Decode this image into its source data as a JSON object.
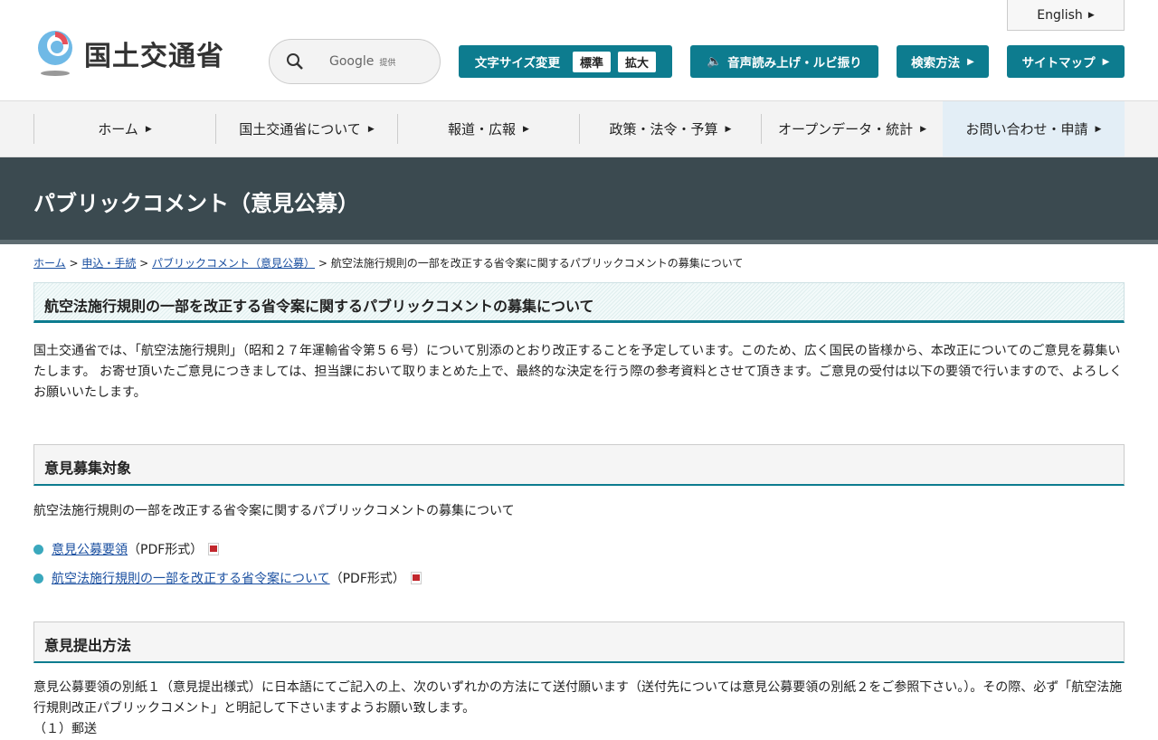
{
  "header": {
    "logo_text": "国土交通省",
    "search_provider": "Google",
    "search_provided": "提供",
    "font_size_label": "文字サイズ変更",
    "font_standard": "標準",
    "font_large": "拡大",
    "speech": "音声読み上げ・ルビ振り",
    "search_method": "検索方法",
    "sitemap": "サイトマップ",
    "english": "English"
  },
  "nav": [
    "ホーム",
    "国土交通省について",
    "報道・広報",
    "政策・法令・予算",
    "オープンデータ・統計",
    "お問い合わせ・申請"
  ],
  "banner": "パブリックコメント（意見公募）",
  "breadcrumb": {
    "home": "ホーム",
    "apply": "申込・手続",
    "pubcom": "パブリックコメント（意見公募）",
    "current": "航空法施行規則の一部を改正する省令案に関するパブリックコメントの募集について"
  },
  "title": "航空法施行規則の一部を改正する省令案に関するパブリックコメントの募集について",
  "intro": "国土交通省では、「航空法施行規則」（昭和２７年運輸省令第５６号）について別添のとおり改正することを予定しています。このため、広く国民の皆様から、本改正についてのご意見を募集いたします。 お寄せ頂いたご意見につきましては、担当課において取りまとめた上で、最終的な決定を行う際の参考資料とさせて頂きます。ご意見の受付は以下の要領で行いますので、よろしくお願いいたします。",
  "section1": {
    "heading": "意見募集対象",
    "text": "航空法施行規則の一部を改正する省令案に関するパブリックコメントの募集について",
    "links": [
      {
        "label": "意見公募要領",
        "suffix": "（PDF形式）"
      },
      {
        "label": "航空法施行規則の一部を改正する省令案について",
        "suffix": "（PDF形式）"
      }
    ]
  },
  "section2": {
    "heading": "意見提出方法",
    "text": "意見公募要領の別紙１（意見提出様式）に日本語にてご記入の上、次のいずれかの方法にて送付願います（送付先については意見公募要領の別紙２をご参照下さい。）。その際、必ず「航空法施行規則改正パブリックコメント」と明記して下さいますようお願い致します。",
    "item1": "（１）郵送"
  }
}
